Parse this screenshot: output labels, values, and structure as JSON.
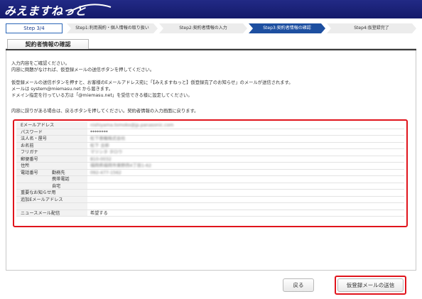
{
  "header": {
    "logo": "みえますねっと"
  },
  "steps": {
    "current": "Step 3/4",
    "items": [
      "Step1:利用規約・個人情報の取り扱い",
      "Step2:契約者情報の入力",
      "Step3:契約者情報の確認",
      "Step4:仮登録完了"
    ],
    "active_color": "#1d4fa0"
  },
  "tab": {
    "label": "契約者情報の確認"
  },
  "intro": {
    "line1": "入力内容をご確認ください。",
    "line2": "内容に問題がなければ、仮登録メールの送信ボタンを押してください。",
    "line3": "仮登録メールの送信ボタンを押すと、お客様のEメールアドレス宛に「【みえますねっと】仮登録完了のお知らせ」のメールが送信されます。",
    "line4": "メールは system@miemasu.net から届きます。",
    "line5": "ドメイン指定を行っている方は「@miemasu.net」を受信できる様に設定してください。",
    "line6": "内容に誤りがある場合は、戻るボタンを押してください。契約者情報の入力画面に戻ります。"
  },
  "form": {
    "rows": [
      {
        "label": "Eメールアドレス",
        "sub": "",
        "value": "nishiyama.tomoko@jp.panasonic.com",
        "blurred": true
      },
      {
        "label": "パスワード",
        "sub": "",
        "value": "********",
        "blurred": false
      },
      {
        "label": "法人名・屋号",
        "sub": "",
        "value": "松下善機株式会社",
        "blurred": true
      },
      {
        "label": "お名前",
        "sub": "",
        "value": "松下 言郎",
        "blurred": true
      },
      {
        "label": "フリガナ",
        "sub": "",
        "value": "マツシタ タロウ",
        "blurred": true
      },
      {
        "label": "郵便番号",
        "sub": "",
        "value": "810-0032",
        "blurred": true
      },
      {
        "label": "住所",
        "sub": "",
        "value": "福岡県福岡市東野西4丁目1-62",
        "blurred": true
      },
      {
        "label": "電話番号",
        "sub": "勤務先",
        "value": "092-477-1562",
        "blurred": true
      },
      {
        "label": "",
        "sub": "携帯電話",
        "value": "",
        "blurred": false
      },
      {
        "label": "",
        "sub": "自宅",
        "value": "",
        "blurred": false
      },
      {
        "label": "重要なお知らせ用",
        "sub": "",
        "value": "",
        "blurred": false
      },
      {
        "label": "追加Eメールアドレス",
        "sub": "",
        "value": "",
        "blurred": false
      },
      {
        "label": "",
        "sub": "",
        "value": "",
        "blurred": false
      },
      {
        "label": "ニュースメール配信",
        "sub": "",
        "value": "希望する",
        "blurred": false
      }
    ]
  },
  "buttons": {
    "back": "戻る",
    "send": "仮登録メールの送信"
  },
  "colors": {
    "header": "#1a217a",
    "highlight": "#e0141c"
  }
}
